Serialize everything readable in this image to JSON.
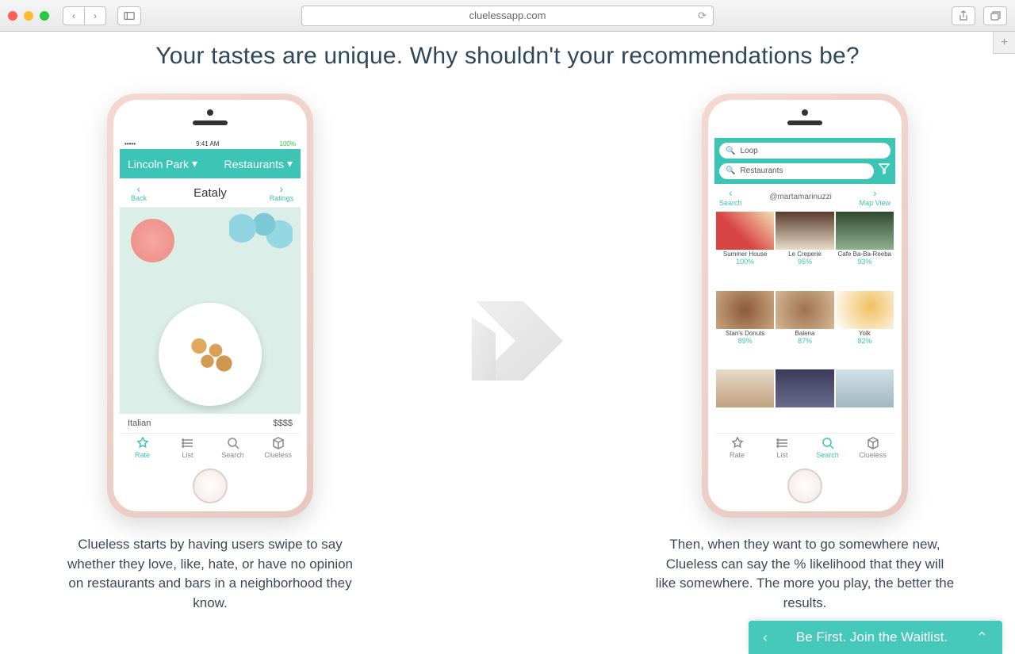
{
  "browser": {
    "url": "cluelessapp.com"
  },
  "headline": "Your tastes are unique. Why shouldn't your recommendations be?",
  "left": {
    "caption": "Clueless starts by having users swipe to say whether they love, like, hate, or have no opinion on restaurants and bars in a neighborhood they know.",
    "status_time": "9:41 AM",
    "status_batt": "100%",
    "location": "Lincoln Park",
    "category": "Restaurants",
    "back": "Back",
    "ratings": "Ratings",
    "place": "Eataly",
    "cuisine": "Italian",
    "price": "$$$$",
    "tabs": {
      "rate": "Rate",
      "list": "List",
      "search": "Search",
      "clueless": "Clueless"
    }
  },
  "right": {
    "caption": "Then, when they want to go somewhere new, Clueless can say the % likelihood that they will like somewhere. The more you play, the better the results.",
    "search1": "Loop",
    "search2": "Restaurants",
    "user": "@martamarinuzzi",
    "nav_left": "Search",
    "nav_right": "Map View",
    "cells": [
      {
        "name": "Summer House",
        "pct": "100%"
      },
      {
        "name": "Le Creperie",
        "pct": "95%"
      },
      {
        "name": "Cafe Ba-Ba-Reeba",
        "pct": "93%"
      },
      {
        "name": "Stan's Donuts",
        "pct": "89%"
      },
      {
        "name": "Balena",
        "pct": "87%"
      },
      {
        "name": "Yolk",
        "pct": "82%"
      }
    ],
    "tabs": {
      "rate": "Rate",
      "list": "List",
      "search": "Search",
      "clueless": "Clueless"
    }
  },
  "waitlist": "Be First. Join the Waitlist."
}
